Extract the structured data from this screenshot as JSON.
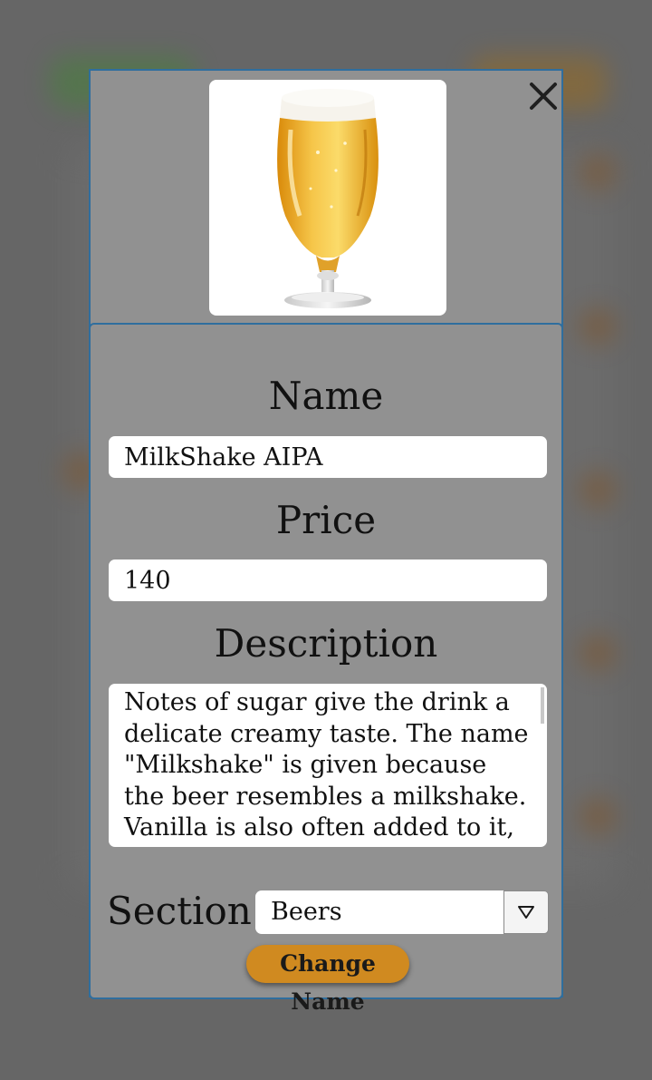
{
  "modal": {
    "close_icon": "close-icon",
    "image_icon": "beer-glass-image"
  },
  "form": {
    "name_label": "Name",
    "name_value": "MilkShake AIPA",
    "price_label": "Price",
    "price_value": "140",
    "description_label": "Description",
    "description_value": "Notes of sugar give the drink a delicate creamy taste. The name \"Milkshake\" is given because the beer resembles a milkshake. Vanilla is also often added to it,",
    "section_label": "Section",
    "section_value": "Beers",
    "submit_label": "Change Name"
  },
  "colors": {
    "modal_bg": "#919191",
    "modal_border": "#2f6e9e",
    "button_bg": "#d08a20",
    "backdrop": "#666666"
  }
}
